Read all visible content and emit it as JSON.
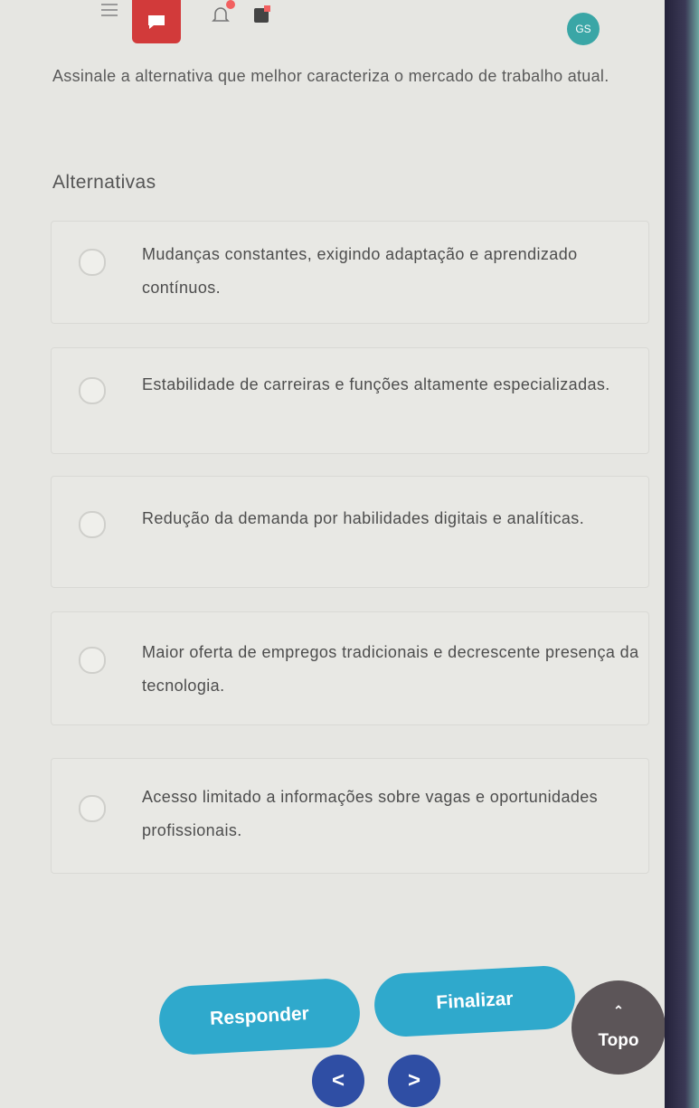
{
  "header": {
    "menu_icon": "hamburger-icon",
    "chat_icon": "chat-bubble-icon",
    "bell_icon": "bell-icon",
    "doc_icon": "document-icon",
    "avatar_text": "GS"
  },
  "question": {
    "text": "Assinale a alternativa que melhor caracteriza o mercado de trabalho atual."
  },
  "alternatives": {
    "title": "Alternativas",
    "options": [
      {
        "label": "Mudanças constantes, exigindo adaptação e aprendizado contínuos."
      },
      {
        "label": "Estabilidade de carreiras e funções altamente especializadas."
      },
      {
        "label": "Redução da demanda por habilidades digitais e analíticas."
      },
      {
        "label": "Maior oferta de empregos tradicionais e decrescente presença da tecnologia."
      },
      {
        "label": "Acesso limitado a informações sobre vagas e oportunidades profissionais."
      }
    ]
  },
  "actions": {
    "responder_label": "Responder",
    "finalizar_label": "Finalizar",
    "topo_label": "Topo",
    "prev_label": "<",
    "next_label": ">"
  },
  "colors": {
    "accent": "#2fa9cc",
    "nav": "#2f4ea4",
    "chat": "#d23a3a",
    "topo": "#5c5558"
  }
}
